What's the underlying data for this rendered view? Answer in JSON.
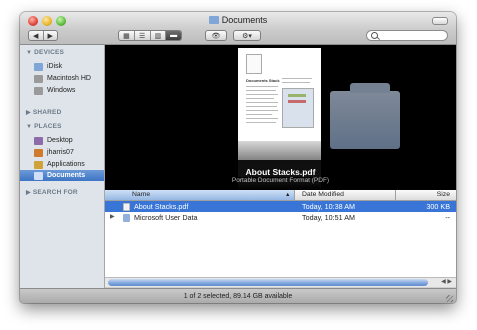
{
  "window": {
    "title": "Documents"
  },
  "toolbar": {
    "back": "◀",
    "forward": "▶",
    "view_icons": "▦",
    "view_list": "☰",
    "view_columns": "▥",
    "view_coverflow": "▬",
    "quicklook": "👁",
    "action": "⚙▾"
  },
  "sidebar": {
    "devices_header": "DEVICES",
    "shared_header": "SHARED",
    "places_header": "PLACES",
    "search_header": "SEARCH FOR",
    "devices": [
      {
        "label": "iDisk",
        "icon": "idisk-icon",
        "color": "#7fa6d6"
      },
      {
        "label": "Macintosh HD",
        "icon": "harddisk-icon",
        "color": "#9a9a9a"
      },
      {
        "label": "Windows",
        "icon": "harddisk-icon",
        "color": "#9a9a9a"
      }
    ],
    "places": [
      {
        "label": "Desktop",
        "icon": "desktop-icon",
        "color": "#8d6aa8"
      },
      {
        "label": "jharris07",
        "icon": "home-icon",
        "color": "#d07a2d"
      },
      {
        "label": "Applications",
        "icon": "applications-icon",
        "color": "#d0a23a"
      },
      {
        "label": "Documents",
        "icon": "documents-folder-icon",
        "color": "#7fa6d6",
        "selected": true
      }
    ]
  },
  "preview": {
    "doc_title": "Documents Stack",
    "name": "About Stacks.pdf",
    "kind": "Portable Document Format (PDF)"
  },
  "list": {
    "columns": {
      "name": "Name",
      "date": "Date Modified",
      "size": "Size"
    },
    "rows": [
      {
        "name": "About Stacks.pdf",
        "date": "Today, 10:38 AM",
        "size": "300 KB",
        "selected": true,
        "icon": "pdf-document-icon"
      },
      {
        "name": "Microsoft User Data",
        "date": "Today, 10:51 AM",
        "size": "--",
        "selected": false,
        "icon": "folder-icon"
      }
    ]
  },
  "status": {
    "text": "1 of 2 selected, 89.14 GB available"
  }
}
